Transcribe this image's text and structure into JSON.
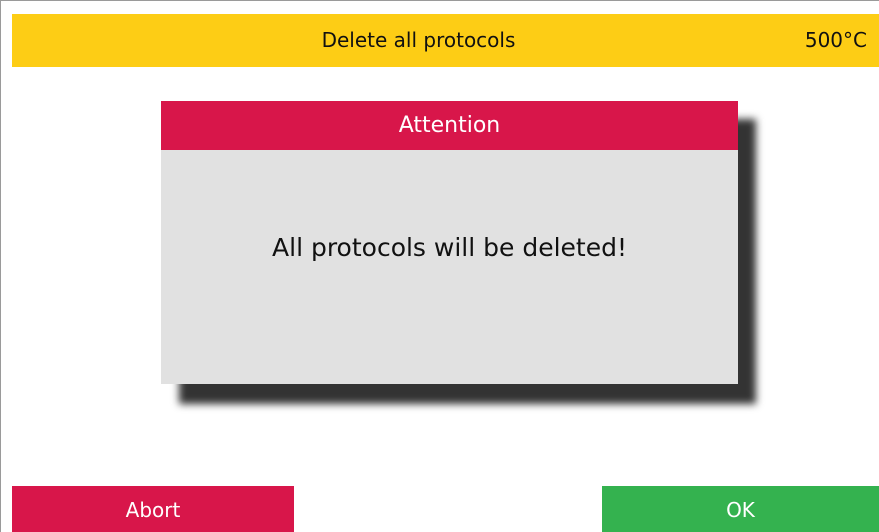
{
  "header": {
    "title": "Delete all protocols",
    "temperature": "500°C"
  },
  "dialog": {
    "title": "Attention",
    "message": "All protocols will be deleted!"
  },
  "buttons": {
    "abort_label": "Abort",
    "ok_label": "OK"
  },
  "colors": {
    "header_bg": "#fdcd15",
    "alert_red": "#d8164a",
    "confirm_green": "#34b24f",
    "dialog_bg": "#e1e1e1"
  }
}
